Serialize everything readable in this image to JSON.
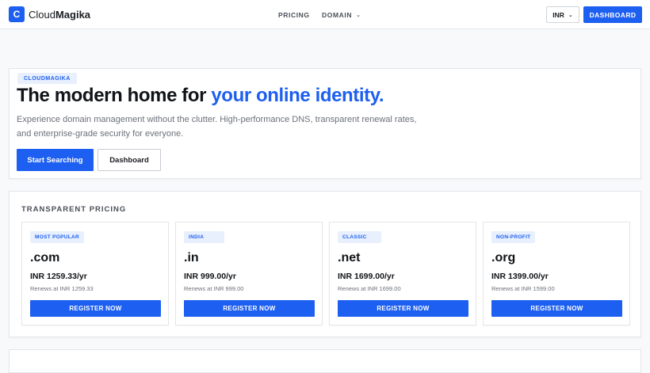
{
  "header": {
    "logo_mark": "C",
    "brand_light": "Cloud",
    "brand_bold": "Magika",
    "nav_pricing": "PRICING",
    "nav_domain": "DOMAIN",
    "currency": "INR",
    "dashboard": "DASHBOARD"
  },
  "hero": {
    "badge": "CLOUDMAGIKA",
    "title_plain": "The modern home for ",
    "title_accent": "your online identity.",
    "description": "Experience domain management without the clutter. High-performance DNS, transparent renewal rates, and enterprise-grade security for everyone.",
    "primary_cta": "Start Searching",
    "secondary_cta": "Dashboard"
  },
  "pricing": {
    "title": "TRANSPARENT PRICING",
    "cards": [
      {
        "tag": "MOST POPULAR",
        "tld": ".com",
        "price": "INR 1259.33/yr",
        "renew": "Renews at INR 1259.33",
        "button": "REGISTER NOW"
      },
      {
        "tag": "INDIA",
        "tld": ".in",
        "price": "INR 999.00/yr",
        "renew": "Renews at INR 999.00",
        "button": "REGISTER NOW"
      },
      {
        "tag": "CLASSIC",
        "tld": ".net",
        "price": "INR 1699.00/yr",
        "renew": "Renews at INR 1699.00",
        "button": "REGISTER NOW"
      },
      {
        "tag": "NON-PROFIT",
        "tld": ".org",
        "price": "INR 1399.00/yr",
        "renew": "Renews at INR 1599.00",
        "button": "REGISTER NOW"
      }
    ]
  },
  "colors": {
    "accent": "#1d5ff0",
    "badge_bg": "#e8f0fe"
  }
}
